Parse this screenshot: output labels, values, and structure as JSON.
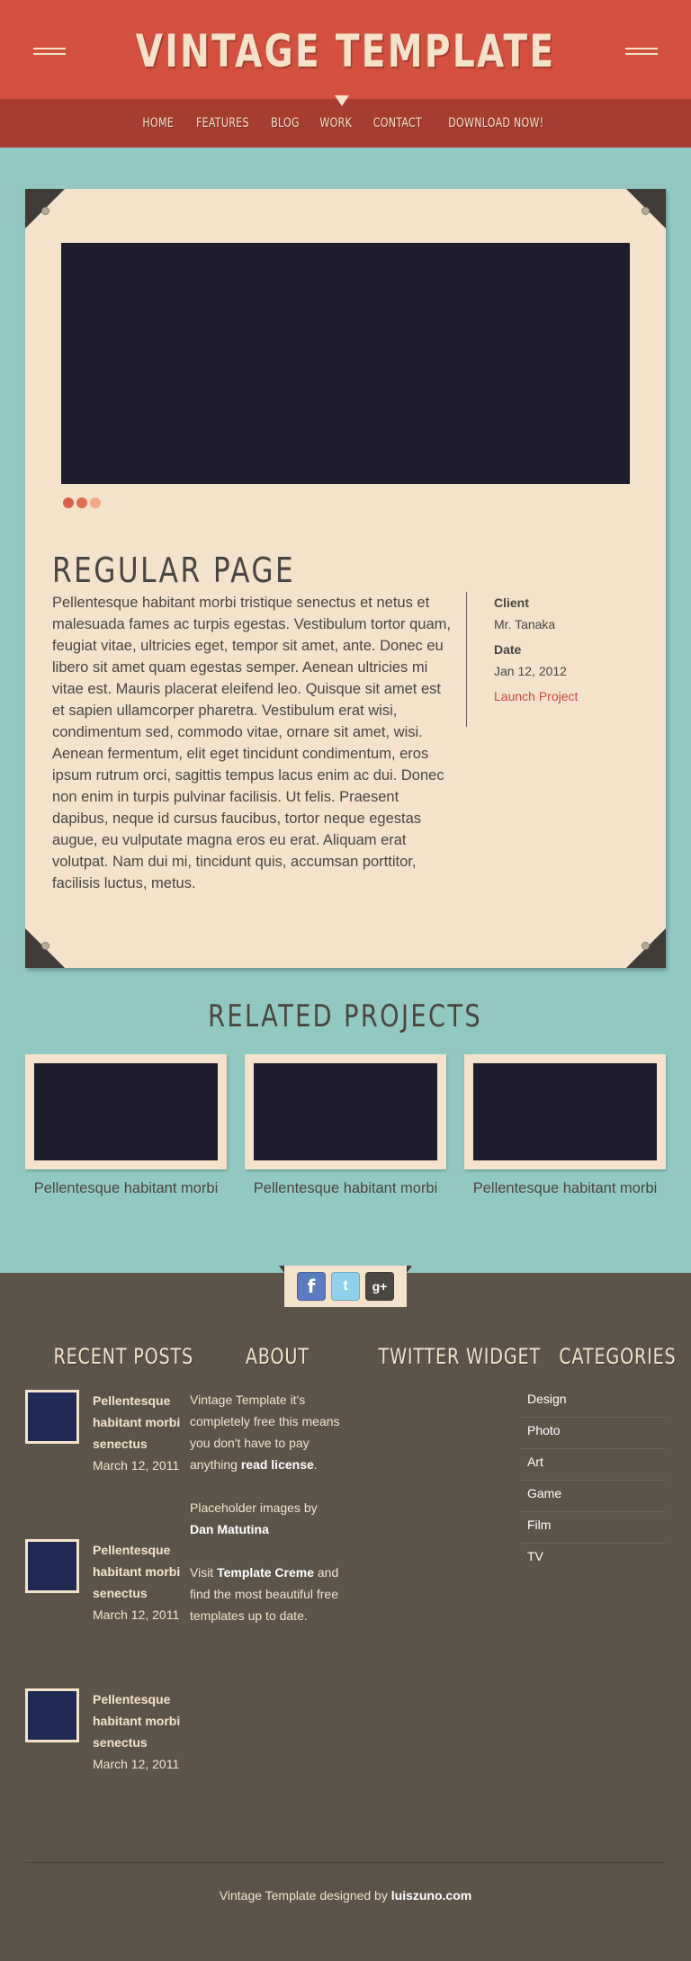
{
  "header": {
    "site_title": "VINTAGE TEMPLATE",
    "nav": [
      "HOME",
      "FEATURES",
      "BLOG",
      "WORK",
      "CONTACT",
      "DOWNLOAD NOW!"
    ]
  },
  "page": {
    "title": "REGULAR PAGE",
    "body": "Pellentesque habitant morbi tristique senectus et netus et malesuada fames ac turpis egestas. Vestibulum tortor quam, feugiat vitae, ultricies eget, tempor sit amet, ante. Donec eu libero sit amet quam egestas semper. Aenean ultricies mi vitae est. Mauris placerat eleifend leo. Quisque sit amet est et sapien ullamcorper pharetra. Vestibulum erat wisi, condimentum sed, commodo vitae, ornare sit amet, wisi. Aenean fermentum, elit eget tincidunt condimentum, eros ipsum rutrum orci, sagittis tempus lacus enim ac dui. Donec non enim in turpis pulvinar facilisis. Ut felis. Praesent dapibus, neque id cursus faucibus, tortor neque egestas augue, eu vulputate magna eros eu erat. Aliquam erat volutpat. Nam dui mi, tincidunt quis, accumsan porttitor, facilisis luctus, metus.",
    "meta": {
      "client_label": "Client",
      "client_value": "Mr. Tanaka",
      "date_label": "Date",
      "date_value": "Jan 12, 2012",
      "link_label": "Launch Project"
    }
  },
  "related": {
    "title": "RELATED PROJECTS",
    "items": [
      {
        "caption": "Pellentesque habitant morbi"
      },
      {
        "caption": "Pellentesque habitant morbi"
      },
      {
        "caption": "Pellentesque habitant morbi"
      }
    ]
  },
  "social": {
    "facebook": "f",
    "twitter": "t",
    "google_plus": "g+"
  },
  "footer": {
    "columns": {
      "recent_posts": "RECENT POSTS",
      "about": "ABOUT",
      "twitter": "TWITTER WIDGET",
      "categories": "CATEGORIES"
    },
    "posts": [
      {
        "title": "Pellentesque habitant morbi senectus",
        "date": "March 12, 2011"
      },
      {
        "title": "Pellentesque habitant morbi senectus",
        "date": "March 12, 2011"
      },
      {
        "title": "Pellentesque habitant morbi senectus",
        "date": "March 12, 2011"
      }
    ],
    "about": {
      "p1_pre": "Vintage Template it's completely free this means you don't have to pay anything ",
      "p1_strong": "read license",
      "p1_post": ".",
      "p2_pre": "Placeholder images by ",
      "p2_strong": "Dan Matutina",
      "p3_pre": "Visit ",
      "p3_strong": "Template Creme",
      "p3_post": " and find the most beautiful free templates up to date."
    },
    "categories": [
      "Design",
      "Photo",
      "Art",
      "Game",
      "Film",
      "TV"
    ],
    "credit_pre": "Vintage Template designed by ",
    "credit_strong": "luiszuno.com"
  },
  "colors": {
    "header_red": "#d35041",
    "nav_red": "#a73c31",
    "teal": "#93c8c2",
    "cream": "#f4e3ca",
    "footer_brown": "#5c5449",
    "slide_dark": "#1e1d2e",
    "accent_link": "#c8493c"
  }
}
